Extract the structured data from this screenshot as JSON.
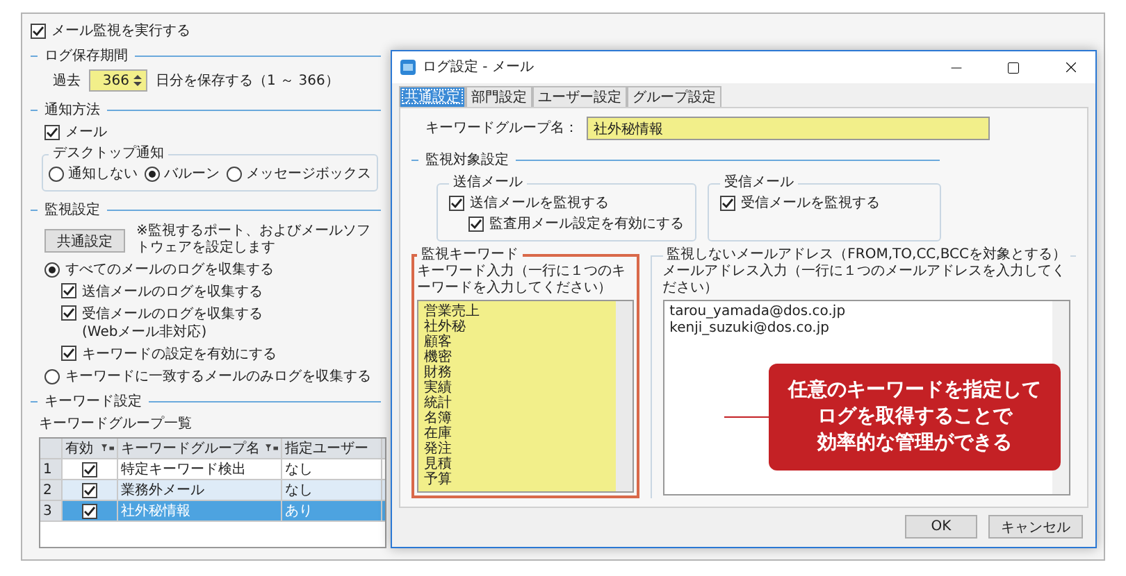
{
  "settings": {
    "monitor_mail": {
      "label": "メール監視を実行する",
      "checked": true
    },
    "log_retention": {
      "title": "ログ保存期間",
      "prefix": "過去",
      "days": "366",
      "suffix": "日分を保存する（1 ～ 366）"
    },
    "notification": {
      "title": "通知方法",
      "mail": {
        "label": "メール",
        "checked": true
      },
      "desktop": {
        "title": "デスクトップ通知",
        "options": [
          {
            "label": "通知しない",
            "selected": false
          },
          {
            "label": "バルーン",
            "selected": true
          },
          {
            "label": "メッセージボックス",
            "selected": false
          }
        ]
      }
    },
    "monitoring": {
      "title": "監視設定",
      "button": "共通設定",
      "note": "※監視するポート、およびメールソフトウェアを設定します",
      "all_mail": {
        "label": "すべてのメールのログを収集する",
        "selected": true
      },
      "options": [
        {
          "label": "送信メールのログを収集する",
          "checked": true
        },
        {
          "label": "受信メールのログを収集する",
          "sublabel": "(Webメール非対応)",
          "checked": true
        },
        {
          "label": "キーワードの設定を有効にする",
          "checked": true
        }
      ],
      "keyword_only": {
        "label": "キーワードに一致するメールのみログを収集する",
        "selected": false
      }
    },
    "keyword_settings": {
      "title": "キーワード設定",
      "list_title": "キーワードグループ一覧",
      "table": {
        "columns": [
          "有効",
          "キーワードグループ名",
          "指定ユーザー"
        ],
        "rows": [
          {
            "index": "1",
            "enabled": true,
            "name": "特定キーワード検出",
            "user": "なし",
            "selected": false
          },
          {
            "index": "2",
            "enabled": true,
            "name": "業務外メール",
            "user": "なし",
            "selected": false
          },
          {
            "index": "3",
            "enabled": true,
            "name": "社外秘情報",
            "user": "あり",
            "selected": true
          }
        ]
      }
    }
  },
  "dialog": {
    "title": "ログ設定 - メール",
    "tabs": [
      {
        "label": "共通設定",
        "selected": true
      },
      {
        "label": "部門設定",
        "selected": false
      },
      {
        "label": "ユーザー設定",
        "selected": false
      },
      {
        "label": "グループ設定",
        "selected": false
      }
    ],
    "group_name": {
      "label": "キーワードグループ名：",
      "value": "社外秘情報"
    },
    "target": {
      "title": "監視対象設定",
      "sent": {
        "title": "送信メール",
        "items": [
          {
            "label": "送信メールを監視する",
            "checked": true
          },
          {
            "label": "監査用メール設定を有効にする",
            "checked": true
          }
        ]
      },
      "received": {
        "title": "受信メール",
        "items": [
          {
            "label": "受信メールを監視する",
            "checked": true
          }
        ]
      }
    },
    "keywords": {
      "title": "監視キーワード",
      "hint": "キーワード入力（一行に１つのキーワードを入力してください）",
      "lines": [
        "営業売上",
        "社外秘",
        "顧客",
        "機密",
        "財務",
        "実績",
        "統計",
        "名簿",
        "在庫",
        "発注",
        "見積",
        "予算"
      ]
    },
    "excluded": {
      "title": "監視しないメールアドレス（FROM,TO,CC,BCCを対象とする）",
      "hint": "メールアドレス入力（一行に１つのメールアドレスを入力してください）",
      "lines": [
        "tarou_yamada@dos.co.jp",
        "kenji_suzuki@dos.co.jp"
      ]
    },
    "buttons": [
      "OK",
      "キャンセル"
    ]
  },
  "callout": {
    "lines": [
      "任意のキーワードを指定して",
      "ログを取得することで",
      "効率的な管理ができる"
    ]
  }
}
